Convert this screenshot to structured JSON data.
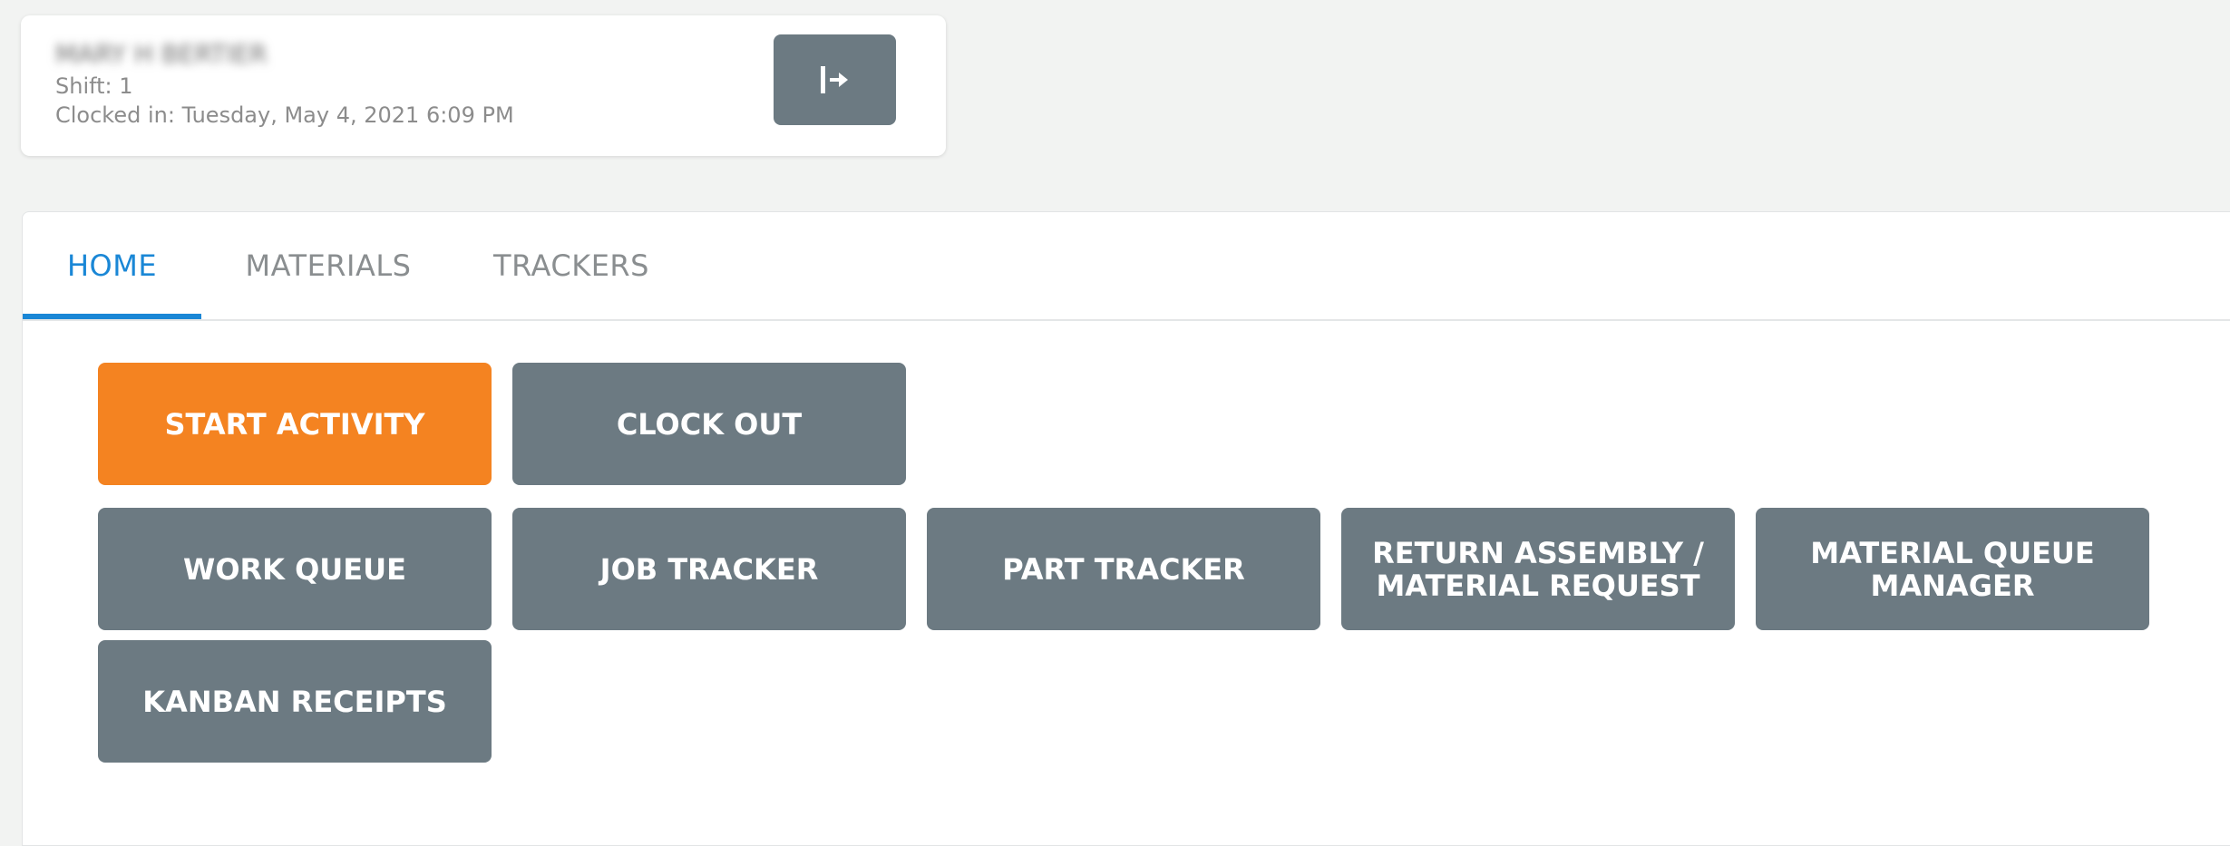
{
  "user_card": {
    "name": "MARY H BERTIER",
    "shift": "Shift: 1",
    "clocked_in": "Clocked in: Tuesday, May 4, 2021 6:09 PM",
    "logout_icon": "logout-arrow-icon"
  },
  "tabs": [
    {
      "label": "HOME",
      "active": true
    },
    {
      "label": "MATERIALS",
      "active": false
    },
    {
      "label": "TRACKERS",
      "active": false
    }
  ],
  "actions": {
    "start_activity": "START ACTIVITY",
    "clock_out": "CLOCK OUT",
    "work_queue": "WORK QUEUE",
    "job_tracker": "JOB TRACKER",
    "part_tracker": "PART TRACKER",
    "return_assembly": "RETURN ASSEMBLY / MATERIAL REQUEST",
    "material_queue_manager": "MATERIAL QUEUE MANAGER",
    "kanban_receipts": "KANBAN RECEIPTS"
  },
  "colors": {
    "accent_orange": "#f48321",
    "button_gray": "#6c7a82",
    "tab_active": "#1a87d6",
    "background": "#f2f3f2"
  }
}
